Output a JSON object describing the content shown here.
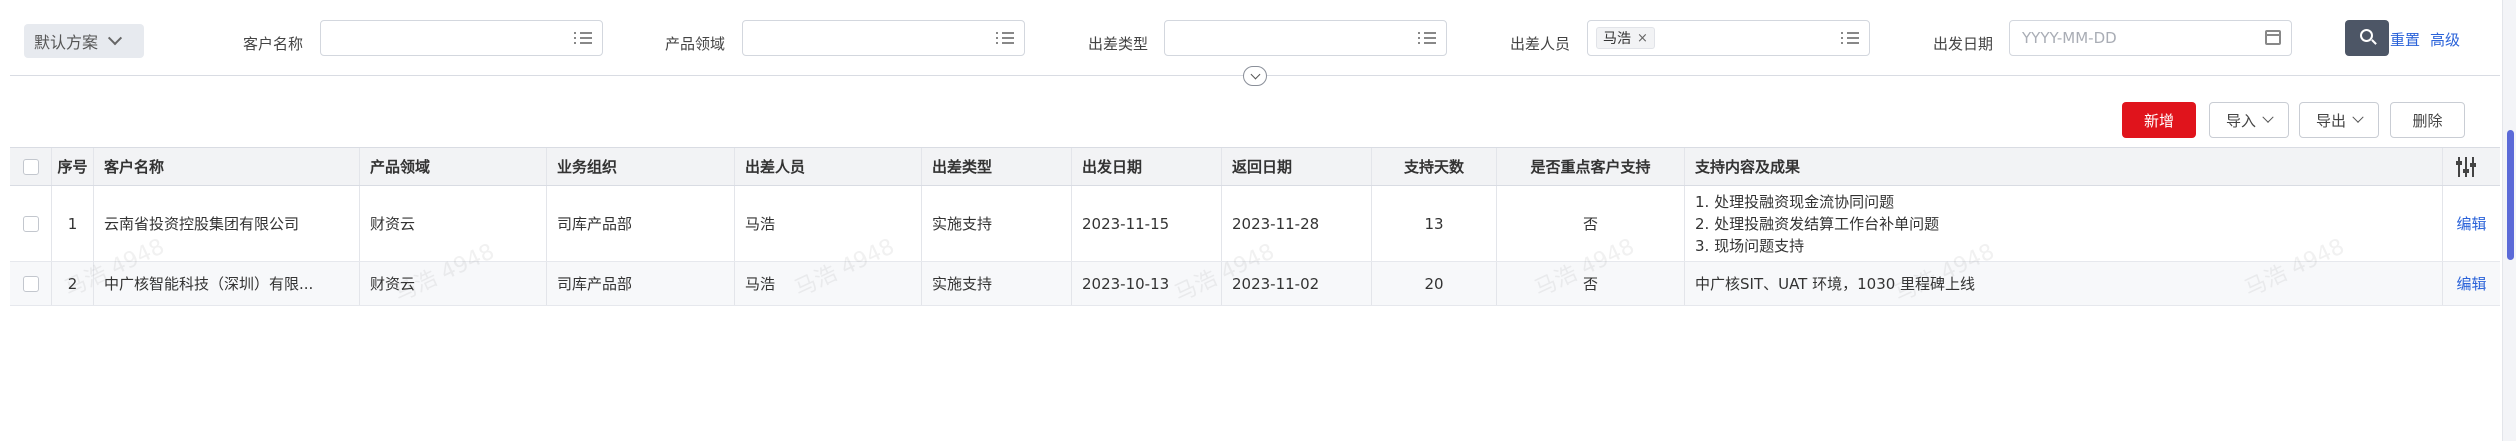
{
  "filter": {
    "scheme": "默认方案",
    "fields": [
      {
        "label": "客户名称",
        "value": ""
      },
      {
        "label": "产品领域",
        "value": ""
      },
      {
        "label": "出差类型",
        "value": ""
      },
      {
        "label": "出差人员",
        "tag": "马浩",
        "tag_close": "×"
      },
      {
        "label": "出发日期",
        "placeholder": "YYYY-MM-DD"
      }
    ],
    "reset": "重置",
    "advanced": "高级"
  },
  "toolbar": {
    "add": "新增",
    "import": "导入",
    "export": "导出",
    "delete": "删除"
  },
  "table": {
    "columns": [
      "序号",
      "客户名称",
      "产品领域",
      "业务组织",
      "出差人员",
      "出差类型",
      "出发日期",
      "返回日期",
      "支持天数",
      "是否重点客户支持",
      "支持内容及成果"
    ],
    "rows": [
      {
        "index": "1",
        "customer": "云南省投资控股集团有限公司",
        "product": "财资云",
        "org": "司库产品部",
        "person": "马浩",
        "type": "实施支持",
        "start": "2023-11-15",
        "end": "2023-11-28",
        "days": "13",
        "key": "否",
        "content": [
          "1. 处理投融资现金流协同问题",
          "2. 处理投融资发结算工作台补单问题",
          "3. 现场问题支持"
        ],
        "action": "编辑"
      },
      {
        "index": "2",
        "customer": "中广核智能科技（深圳）有限...",
        "product": "财资云",
        "org": "司库产品部",
        "person": "马浩",
        "type": "实施支持",
        "start": "2023-10-13",
        "end": "2023-11-02",
        "days": "20",
        "key": "否",
        "content": [
          "中广核SIT、UAT 环境，1030 里程碑上线"
        ],
        "action": "编辑"
      }
    ]
  },
  "watermark": "马浩 4948",
  "colors": {
    "primary": "#e0141c",
    "link": "#2b63d9",
    "search_button": "#4d5666",
    "header_bg": "#f2f3f5"
  }
}
